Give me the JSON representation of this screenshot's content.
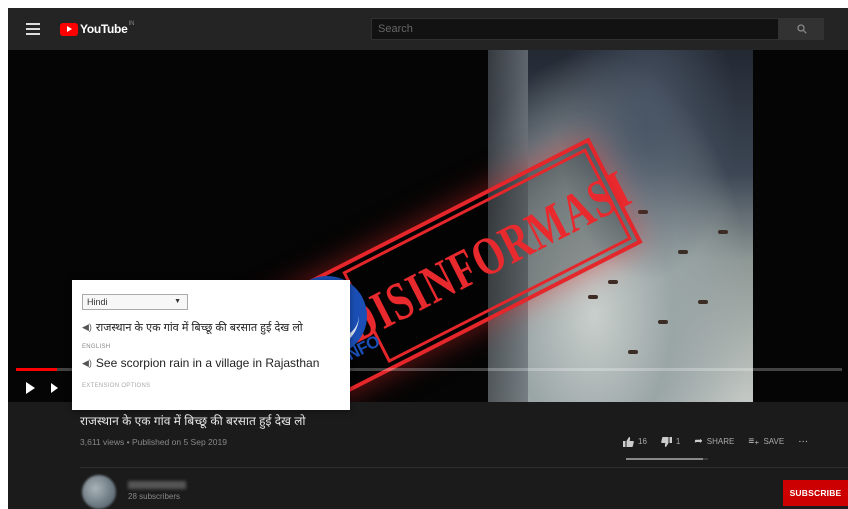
{
  "header": {
    "logo_text": "YouTube",
    "logo_sup": "IN",
    "search_placeholder": "Search"
  },
  "video": {
    "stamp_text": "DISINFORMASI",
    "stamp_logo_text": "KOMINFO",
    "progress_fraction": 0.05
  },
  "translate_popup": {
    "selected_language": "Hindi",
    "source_text": "राजस्थान के एक गांव में बिच्छू की बरसात हुई देख लो",
    "target_label": "ENGLISH",
    "translation": "See scorpion rain in a village in Rajasthan",
    "extension_options": "EXTENSION OPTIONS"
  },
  "video_info": {
    "title": "राजस्थान के एक गांव में बिच्छू की बरसात हुई देख लो",
    "meta": "3,611 views • Published on 5 Sep 2019",
    "likes": "16",
    "dislikes": "1",
    "share_label": "SHARE",
    "save_label": "SAVE",
    "more_label": "···",
    "like_ratio": 0.94
  },
  "channel": {
    "subscribers": "28 subscribers",
    "subscribe_label": "SUBSCRIBE"
  },
  "colors": {
    "brand_red": "#ff0000",
    "stamp_red": "#e5262b",
    "kominfo_blue": "#1b4fb5"
  }
}
